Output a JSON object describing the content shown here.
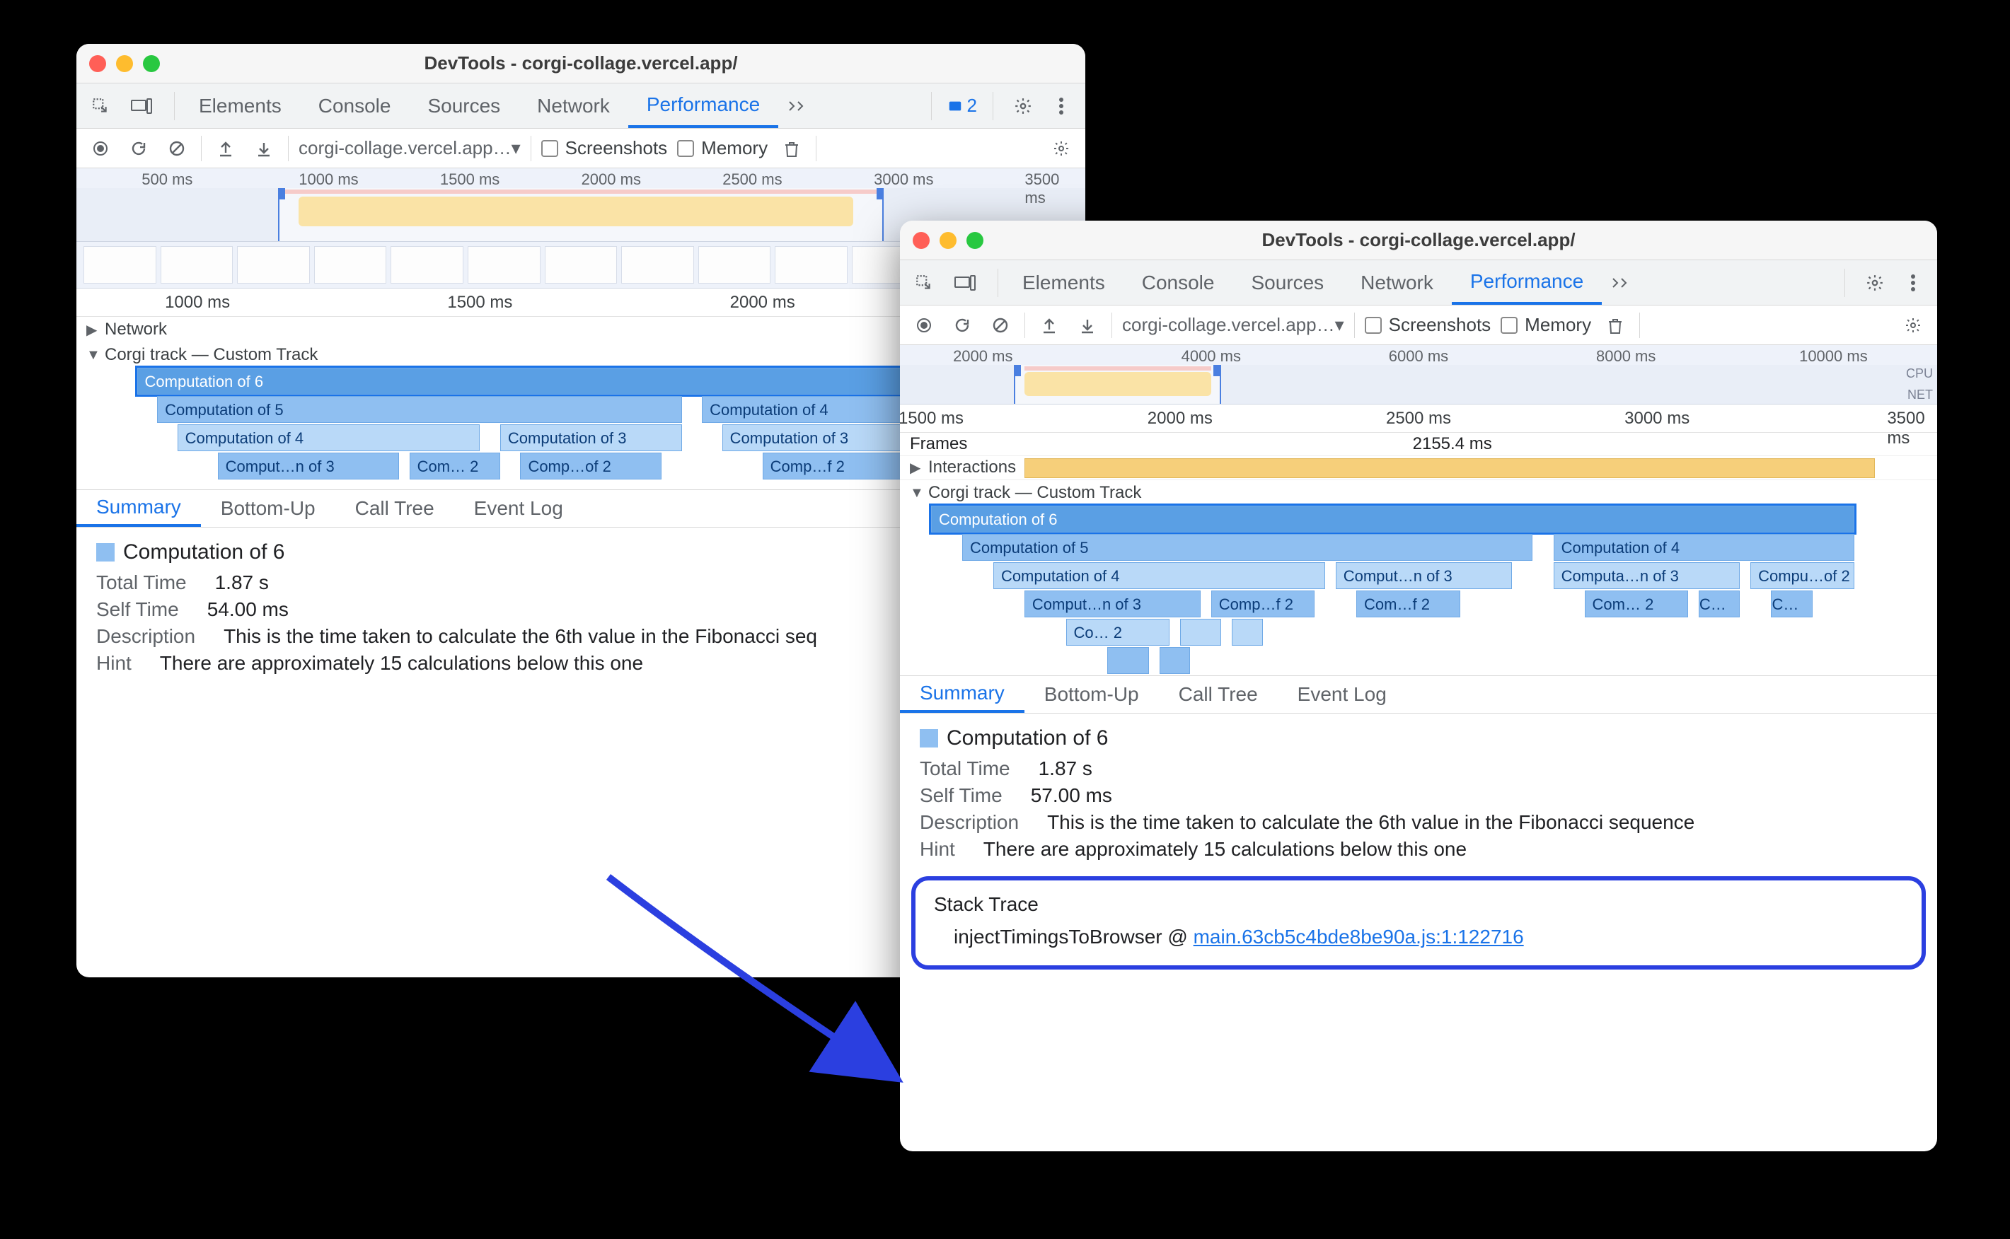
{
  "window1": {
    "title": "DevTools - corgi-collage.vercel.app/",
    "tabs": [
      "Elements",
      "Console",
      "Sources",
      "Network",
      "Performance"
    ],
    "active_tab": "Performance",
    "issue_count": "2",
    "toolbar": {
      "url": "corgi-collage.vercel.app…▾",
      "screenshots_label": "Screenshots",
      "memory_label": "Memory"
    },
    "overview_ticks": [
      {
        "label": "500 ms",
        "pct": 9
      },
      {
        "label": "1000 ms",
        "pct": 25
      },
      {
        "label": "1500 ms",
        "pct": 39
      },
      {
        "label": "2000 ms",
        "pct": 53
      },
      {
        "label": "2500 ms",
        "pct": 67
      },
      {
        "label": "3000 ms",
        "pct": 82
      },
      {
        "label": "3500 ms",
        "pct": 96
      }
    ],
    "detail_ticks": [
      {
        "label": "1000 ms",
        "pct": 12
      },
      {
        "label": "1500 ms",
        "pct": 40
      },
      {
        "label": "2000 ms",
        "pct": 68
      }
    ],
    "network_label": "Network",
    "custom_track_label": "Corgi track — Custom Track",
    "flame": {
      "r0": "Computation of 6",
      "r1a": "Computation of 5",
      "r1b": "Computation of 4",
      "r2a": "Computation of 4",
      "r2b": "Computation of 3",
      "r2c": "Computation of 3",
      "r3a": "Comput…n of 3",
      "r3b": "Com… 2",
      "r3c": "Comp…of 2",
      "r3d": "Comp…f 2"
    },
    "bottom_tabs": [
      "Summary",
      "Bottom-Up",
      "Call Tree",
      "Event Log"
    ],
    "summary": {
      "heading": "Computation of 6",
      "total_time_k": "Total Time",
      "total_time_v": "1.87 s",
      "self_time_k": "Self Time",
      "self_time_v": "54.00 ms",
      "desc_k": "Description",
      "desc_v": "This is the time taken to calculate the 6th value in the Fibonacci seq",
      "hint_k": "Hint",
      "hint_v": "There are approximately 15 calculations below this one"
    }
  },
  "window2": {
    "title": "DevTools - corgi-collage.vercel.app/",
    "tabs": [
      "Elements",
      "Console",
      "Sources",
      "Network",
      "Performance"
    ],
    "active_tab": "Performance",
    "toolbar": {
      "url": "corgi-collage.vercel.app…▾",
      "screenshots_label": "Screenshots",
      "memory_label": "Memory"
    },
    "overview_ticks": [
      {
        "label": "2000 ms",
        "pct": 8
      },
      {
        "label": "4000 ms",
        "pct": 30
      },
      {
        "label": "6000 ms",
        "pct": 50
      },
      {
        "label": "8000 ms",
        "pct": 70
      },
      {
        "label": "10000 ms",
        "pct": 90
      }
    ],
    "ov_labels": {
      "cpu": "CPU",
      "net": "NET"
    },
    "detail_ticks": [
      {
        "label": "1500 ms",
        "pct": 3
      },
      {
        "label": "2000 ms",
        "pct": 27
      },
      {
        "label": "2500 ms",
        "pct": 50
      },
      {
        "label": "3000 ms",
        "pct": 73
      },
      {
        "label": "3500 ms",
        "pct": 97
      }
    ],
    "frames_label": "Frames",
    "frames_time": "2155.4 ms",
    "interactions_label": "Interactions",
    "custom_track_label": "Corgi track — Custom Track",
    "flame": {
      "r0": "Computation of 6",
      "r1a": "Computation of 5",
      "r1b": "Computation of 4",
      "r2a": "Computation of 4",
      "r2b": "Comput…n of 3",
      "r2c": "Computa…n of 3",
      "r2d": "Compu…of 2",
      "r3a": "Comput…n of 3",
      "r3b": "Comp…f 2",
      "r3c": "Com…f 2",
      "r3d": "Com… 2",
      "r3e": "C…",
      "r3f": "C…",
      "r4a": "Co… 2"
    },
    "bottom_tabs": [
      "Summary",
      "Bottom-Up",
      "Call Tree",
      "Event Log"
    ],
    "summary": {
      "heading": "Computation of 6",
      "total_time_k": "Total Time",
      "total_time_v": "1.87 s",
      "self_time_k": "Self Time",
      "self_time_v": "57.00 ms",
      "desc_k": "Description",
      "desc_v": "This is the time taken to calculate the 6th value in the Fibonacci sequence",
      "hint_k": "Hint",
      "hint_v": "There are approximately 15 calculations below this one"
    },
    "stack": {
      "title": "Stack Trace",
      "fn": "injectTimingsToBrowser",
      "at": "@",
      "link": "main.63cb5c4bde8be90a.js:1:122716"
    }
  }
}
